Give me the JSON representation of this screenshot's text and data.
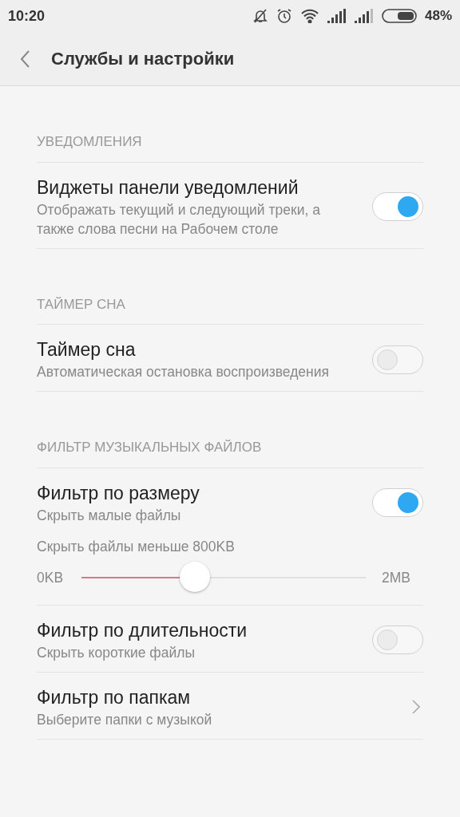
{
  "status_bar": {
    "time": "10:20",
    "battery": "48%"
  },
  "header": {
    "title": "Службы и настройки"
  },
  "sections": [
    {
      "title": "УВЕДОМЛЕНИЯ",
      "items": [
        {
          "kind": "toggle",
          "title": "Виджеты панели уведомлений",
          "subtitle": "Отображать текущий и следующий треки, а также слова песни на Рабочем столе",
          "on": true
        }
      ]
    },
    {
      "title": "ТАЙМЕР СНА",
      "items": [
        {
          "kind": "toggle",
          "title": "Таймер сна",
          "subtitle": "Автоматическая остановка воспроизведения",
          "on": false
        }
      ]
    },
    {
      "title": "ФИЛЬТР МУЗЫКАЛЬНЫХ ФАЙЛОВ",
      "items": [
        {
          "kind": "toggle",
          "title": "Фильтр по размеру",
          "subtitle": "Скрыть малые файлы",
          "on": true,
          "slider": {
            "label": "Скрыть файлы меньше 800KB",
            "min_label": "0KB",
            "max_label": "2MB",
            "level": 0.4
          }
        },
        {
          "kind": "toggle",
          "title": "Фильтр по длительности",
          "subtitle": "Скрыть короткие файлы",
          "on": false
        },
        {
          "kind": "link",
          "title": "Фильтр по папкам",
          "subtitle": "Выберите папки с музыкой"
        }
      ]
    }
  ]
}
